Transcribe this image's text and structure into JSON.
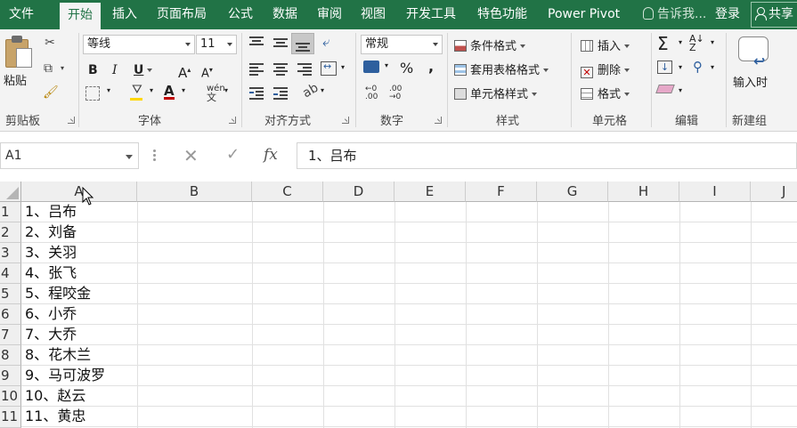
{
  "menubar": {
    "tabs": [
      "文件",
      "开始",
      "插入",
      "页面布局",
      "公式",
      "数据",
      "审阅",
      "视图",
      "开发工具",
      "特色功能",
      "Power Pivot"
    ],
    "active_tab": "开始",
    "tell_me": "告诉我...",
    "login": "登录",
    "share": "共享"
  },
  "ribbon": {
    "clipboard": {
      "paste": "粘贴",
      "label": "剪贴板"
    },
    "font": {
      "name": "等线",
      "size": "11",
      "bold": "B",
      "italic": "I",
      "underline": "U",
      "grow": "A",
      "shrink": "A",
      "font_color": "A",
      "phonetic": "wén",
      "label": "字体"
    },
    "alignment": {
      "label": "对齐方式"
    },
    "number": {
      "format": "常规",
      "percent": "%",
      "comma": ",",
      "label": "数字"
    },
    "styles": {
      "conditional": "条件格式",
      "table": "套用表格格式",
      "cell_styles": "单元格样式",
      "label": "样式"
    },
    "cells": {
      "insert": "插入",
      "delete": "删除",
      "format": "格式",
      "label": "单元格"
    },
    "editing": {
      "sum": "Σ",
      "label": "编辑"
    },
    "newgroup": {
      "input_time": "输入时",
      "label": "新建组"
    }
  },
  "formula_bar": {
    "namebox": "A1",
    "cancel": "✕",
    "enter": "✓",
    "fx": "fx",
    "content": "1、吕布"
  },
  "sheet": {
    "columns": [
      "A",
      "B",
      "C",
      "D",
      "E",
      "F",
      "G",
      "H",
      "I",
      "J"
    ],
    "rows": [
      "1",
      "2",
      "3",
      "4",
      "5",
      "6",
      "7",
      "8",
      "9",
      "10",
      "11"
    ],
    "cells_A": [
      "1、吕布",
      "2、刘备",
      "3、关羽",
      "4、张飞",
      "5、程咬金",
      "6、小乔",
      "7、大乔",
      "8、花木兰",
      "9、马可波罗",
      "10、赵云",
      "11、黄忠"
    ]
  },
  "colors": {
    "brand": "#217346",
    "ribbon_bg": "#f3f3f3",
    "header_bg": "#efefef",
    "gridline": "#e1e1e1"
  }
}
